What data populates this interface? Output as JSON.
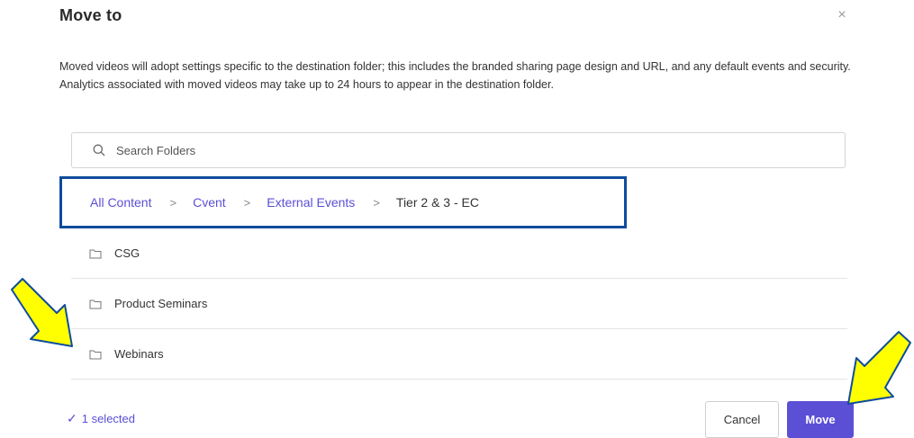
{
  "dialog": {
    "title": "Move to",
    "close_glyph": "×",
    "description": "Moved videos will adopt settings specific to the destination folder; this includes the branded sharing page design and URL, and any default events and security. Analytics associated with moved videos may take up to 24 hours to appear in the destination folder."
  },
  "search": {
    "placeholder": "Search Folders",
    "icon": "search-icon"
  },
  "breadcrumb": {
    "items": [
      {
        "label": "All Content"
      },
      {
        "label": "Cvent"
      },
      {
        "label": "External Events"
      }
    ],
    "separator": ">",
    "current": "Tier 2 & 3 - EC"
  },
  "folders": [
    {
      "name": "CSG",
      "icon": "folder-icon"
    },
    {
      "name": "Product Seminars",
      "icon": "folder-icon"
    },
    {
      "name": "Webinars",
      "icon": "folder-icon"
    }
  ],
  "footer": {
    "selected_check": "✓",
    "selected_text": "1 selected",
    "cancel_label": "Cancel",
    "move_label": "Move"
  },
  "colors": {
    "accent": "#5b4fd6",
    "highlight_border": "#0e4c9c",
    "annotation_arrow": "#ffff00"
  }
}
